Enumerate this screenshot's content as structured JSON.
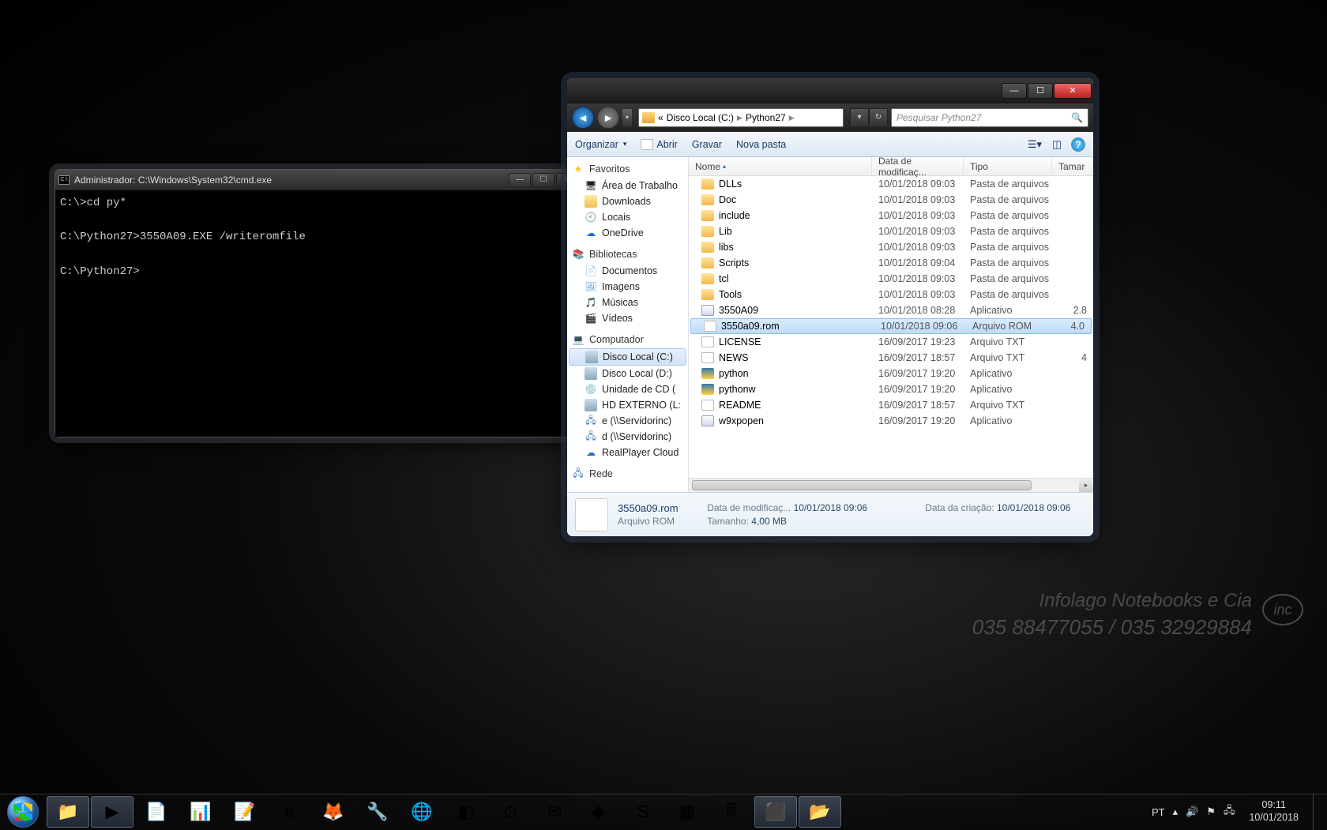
{
  "cmd": {
    "title": "Administrador: C:\\Windows\\System32\\cmd.exe",
    "lines": "C:\\>cd py*\n\nC:\\Python27>3550A09.EXE /writeromfile\n\nC:\\Python27>"
  },
  "explorer": {
    "address": {
      "prefix": "«",
      "crumbs": [
        "Disco Local (C:)",
        "Python27"
      ]
    },
    "search_placeholder": "Pesquisar Python27",
    "toolbar": {
      "organize": "Organizar",
      "open": "Abrir",
      "burn": "Gravar",
      "newfolder": "Nova pasta"
    },
    "sidebar": {
      "favorites": {
        "label": "Favoritos",
        "items": [
          "Área de Trabalho",
          "Downloads",
          "Locais",
          "OneDrive"
        ]
      },
      "libraries": {
        "label": "Bibliotecas",
        "items": [
          "Documentos",
          "Imagens",
          "Músicas",
          "Vídeos"
        ]
      },
      "computer": {
        "label": "Computador",
        "items": [
          "Disco Local (C:)",
          "Disco Local (D:)",
          "Unidade de CD (",
          "HD EXTERNO (L:",
          "e (\\\\Servidorinc)",
          "d (\\\\Servidorinc)",
          "RealPlayer Cloud"
        ]
      },
      "network": {
        "label": "Rede"
      }
    },
    "columns": {
      "name": "Nome",
      "date": "Data de modificaç...",
      "type": "Tipo",
      "size": "Tamar"
    },
    "files": [
      {
        "icon": "folder",
        "name": "DLLs",
        "date": "10/01/2018 09:03",
        "type": "Pasta de arquivos",
        "size": ""
      },
      {
        "icon": "folder",
        "name": "Doc",
        "date": "10/01/2018 09:03",
        "type": "Pasta de arquivos",
        "size": ""
      },
      {
        "icon": "folder",
        "name": "include",
        "date": "10/01/2018 09:03",
        "type": "Pasta de arquivos",
        "size": ""
      },
      {
        "icon": "folder",
        "name": "Lib",
        "date": "10/01/2018 09:03",
        "type": "Pasta de arquivos",
        "size": ""
      },
      {
        "icon": "folder",
        "name": "libs",
        "date": "10/01/2018 09:03",
        "type": "Pasta de arquivos",
        "size": ""
      },
      {
        "icon": "folder",
        "name": "Scripts",
        "date": "10/01/2018 09:04",
        "type": "Pasta de arquivos",
        "size": ""
      },
      {
        "icon": "folder",
        "name": "tcl",
        "date": "10/01/2018 09:03",
        "type": "Pasta de arquivos",
        "size": ""
      },
      {
        "icon": "folder",
        "name": "Tools",
        "date": "10/01/2018 09:03",
        "type": "Pasta de arquivos",
        "size": ""
      },
      {
        "icon": "exe",
        "name": "3550A09",
        "date": "10/01/2018 08:28",
        "type": "Aplicativo",
        "size": "2.8"
      },
      {
        "icon": "rom",
        "name": "3550a09.rom",
        "date": "10/01/2018 09:06",
        "type": "Arquivo ROM",
        "size": "4.0",
        "selected": true
      },
      {
        "icon": "txt",
        "name": "LICENSE",
        "date": "16/09/2017 19:23",
        "type": "Arquivo TXT",
        "size": ""
      },
      {
        "icon": "txt",
        "name": "NEWS",
        "date": "16/09/2017 18:57",
        "type": "Arquivo TXT",
        "size": "4"
      },
      {
        "icon": "py",
        "name": "python",
        "date": "16/09/2017 19:20",
        "type": "Aplicativo",
        "size": ""
      },
      {
        "icon": "py",
        "name": "pythonw",
        "date": "16/09/2017 19:20",
        "type": "Aplicativo",
        "size": ""
      },
      {
        "icon": "txt",
        "name": "README",
        "date": "16/09/2017 18:57",
        "type": "Arquivo TXT",
        "size": ""
      },
      {
        "icon": "exe",
        "name": "w9xpopen",
        "date": "16/09/2017 19:20",
        "type": "Aplicativo",
        "size": ""
      }
    ],
    "details": {
      "filename": "3550a09.rom",
      "filetype": "Arquivo ROM",
      "mod_label": "Data de modificaç...",
      "mod_value": "10/01/2018 09:06",
      "size_label": "Tamanho:",
      "size_value": "4,00 MB",
      "created_label": "Data da criação:",
      "created_value": "10/01/2018 09:06"
    }
  },
  "watermark": {
    "line1": "Infolago Notebooks e Cia",
    "line2": "035 88477055 / 035 32929884",
    "badge": "inc"
  },
  "taskbar": {
    "lang": "PT",
    "time": "09:11",
    "date": "10/01/2018",
    "apps": [
      "explorer",
      "media",
      "doc",
      "excel",
      "word",
      "ie",
      "firefox",
      "tool",
      "chrome",
      "app1",
      "teamviewer",
      "mail",
      "app2",
      "skype",
      "app3",
      "calc",
      "cmd",
      "folder2"
    ]
  }
}
